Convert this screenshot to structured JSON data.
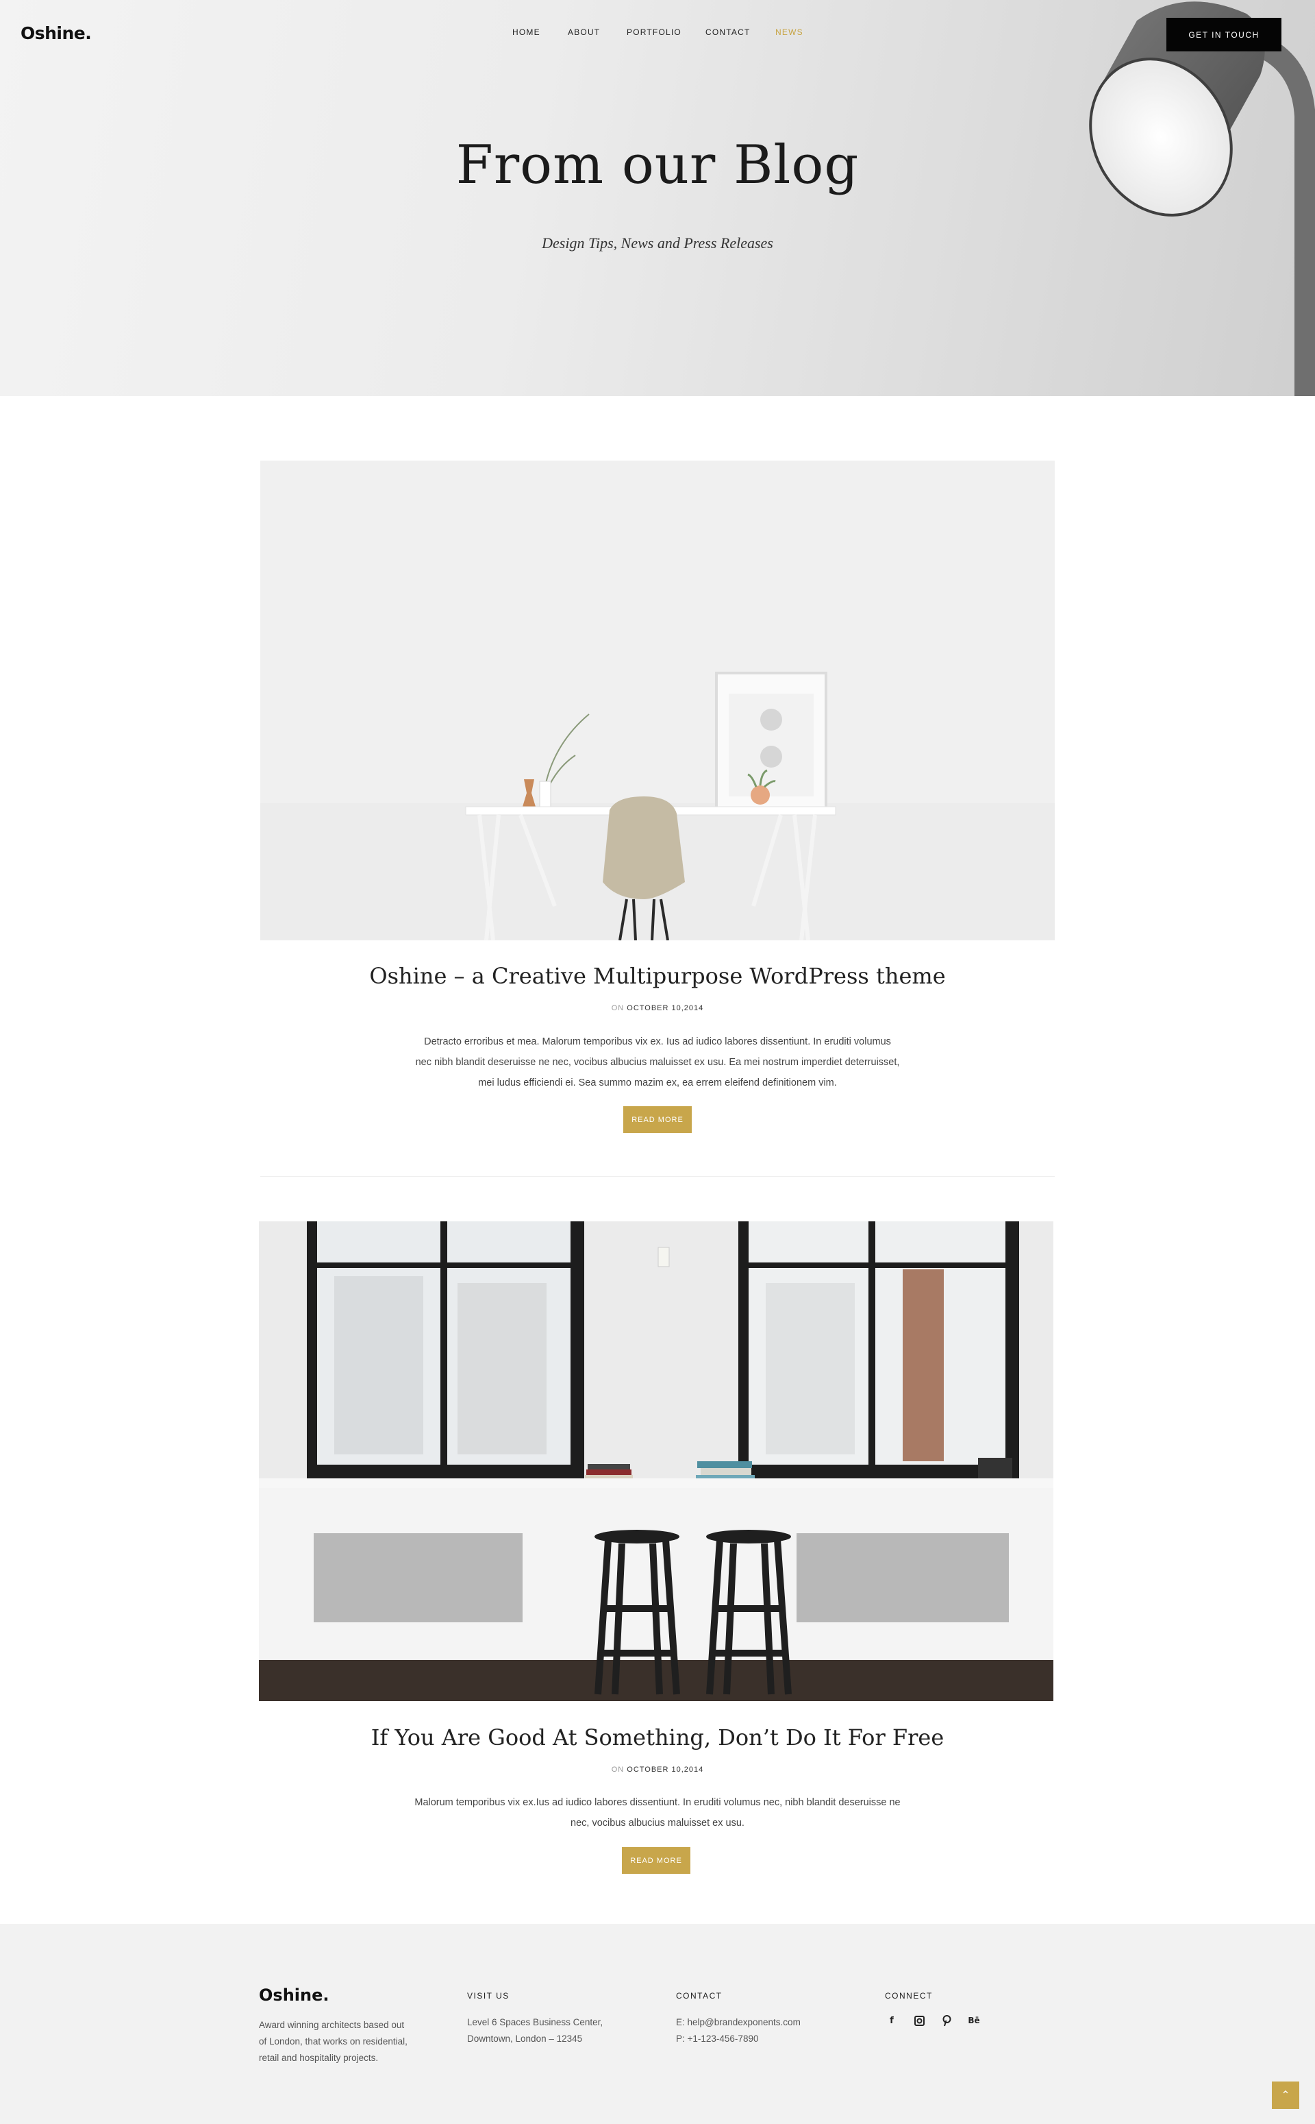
{
  "brand": {
    "logo": "Oshine."
  },
  "nav": {
    "items": [
      {
        "label": "HOME",
        "active": false
      },
      {
        "label": "ABOUT",
        "active": false
      },
      {
        "label": "PORTFOLIO",
        "active": false
      },
      {
        "label": "CONTACT",
        "active": false
      },
      {
        "label": "NEWS",
        "active": true
      }
    ],
    "cta_label": "GET IN TOUCH"
  },
  "hero": {
    "title": "From our Blog",
    "subtitle": "Design Tips, News and Press Releases"
  },
  "posts": [
    {
      "title": "Oshine – a Creative Multipurpose WordPress theme",
      "meta_prefix": "ON",
      "date": "OCTOBER 10,2014",
      "excerpt_lines": [
        "Detracto erroribus et mea. Malorum temporibus vix ex. Ius ad iudico labores dissentiunt. In eruditi volumus",
        "nec nibh blandit deseruisse ne nec, vocibus albucius maluisset ex usu. Ea mei nostrum imperdiet deterruisset,",
        "mei ludus efficiendi ei. Sea summo mazim ex, ea errem eleifend definitionem vim."
      ],
      "read_more": "READ MORE"
    },
    {
      "title": "If You Are Good At Something, Don’t Do It For Free",
      "meta_prefix": "ON",
      "date": "OCTOBER 10,2014",
      "excerpt_lines": [
        "Malorum temporibus vix ex.Ius ad iudico labores dissentiunt. In eruditi volumus nec, nibh blandit deseruisse ne",
        "nec, vocibus albucius maluisset ex usu."
      ],
      "read_more": "READ MORE"
    }
  ],
  "footer": {
    "logo": "Oshine.",
    "about_lines": [
      "Award winning architects based out",
      "of London, that works on residential,",
      "retail and hospitality projects."
    ],
    "visit": {
      "heading": "VISIT US",
      "lines": [
        "Level 6 Spaces Business Center,",
        "Downtown, London – 12345"
      ]
    },
    "contact": {
      "heading": "CONTACT",
      "lines": [
        "E: help@brandexponents.com",
        "P: +1-123-456-7890"
      ]
    },
    "connect": {
      "heading": "CONNECT",
      "icons": [
        "facebook-icon",
        "instagram-icon",
        "pinterest-icon",
        "behance-icon"
      ]
    }
  },
  "colors": {
    "accent": "#c8a64b",
    "dark": "#050505",
    "footer_bg": "#f2f2f2"
  }
}
